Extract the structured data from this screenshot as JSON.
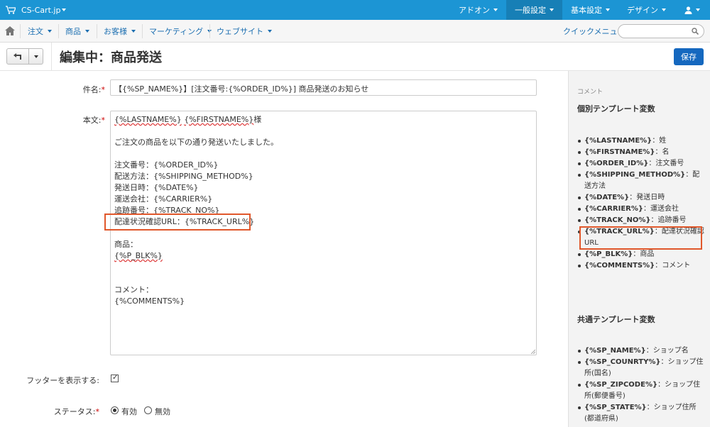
{
  "topbar": {
    "brand": "CS-Cart.jp",
    "menus": [
      {
        "label": "アドオン"
      },
      {
        "label": "一般設定"
      },
      {
        "label": "基本設定"
      },
      {
        "label": "デザイン"
      }
    ]
  },
  "subnav": {
    "items": [
      {
        "label": "注文"
      },
      {
        "label": "商品"
      },
      {
        "label": "お客様"
      },
      {
        "label": "マーケティング"
      },
      {
        "label": "ウェブサイト"
      }
    ],
    "quick_menu": "クイックメニュー",
    "search_placeholder": ""
  },
  "page": {
    "title": "編集中：商品発送",
    "save_label": "保存"
  },
  "form": {
    "subject_label": "件名:",
    "subject_value": "【{%SP_NAME%}】[注文番号:{%ORDER_ID%}] 商品発送のお知らせ",
    "body_label": "本文:",
    "body": {
      "name_a": "{%LASTNAME%}",
      "name_b": "{%FIRSTNAME%}",
      "name_suffix": "様",
      "intro": "ご注文の商品を以下の通り発送いたしました。",
      "order_id": "注文番号：{%ORDER_ID%}",
      "shipping_method": "配送方法：{%SHIPPING_METHOD%}",
      "date": "発送日時：{%DATE%}",
      "carrier": "運送会社：{%CARRIER%}",
      "track_no": "追跡番号：{%TRACK_NO%}",
      "track_url": "配達状況確認URL：{%TRACK_URL%}",
      "products_label": "商品：",
      "p_blk": "{%P_BLK%}",
      "comment_label": "コメント：",
      "comments": "{%COMMENTS%}"
    },
    "footer_label": "フッターを表示する:",
    "status_label": "ステータス:",
    "status_options": [
      {
        "label": "有効",
        "selected": true
      },
      {
        "label": "無効",
        "selected": false
      }
    ]
  },
  "sidebar": {
    "small_label": "コメント",
    "individual_title": "個別テンプレート変数",
    "individual_vars": [
      {
        "var": "{%LASTNAME%}",
        "desc": "：姓"
      },
      {
        "var": "{%FIRSTNAME%}",
        "desc": "：名"
      },
      {
        "var": "{%ORDER_ID%}",
        "desc": "：注文番号"
      },
      {
        "var": "{%SHIPPING_METHOD%}",
        "desc": "：配送方法"
      },
      {
        "var": "{%DATE%}",
        "desc": "：発送日時"
      },
      {
        "var": "{%CARRIER%}",
        "desc": "：運送会社"
      },
      {
        "var": "{%TRACK_NO%}",
        "desc": "：追跡番号"
      },
      {
        "var": "{%TRACK_URL%}",
        "desc": "：配達状況確認URL"
      },
      {
        "var": "{%P_BLK%}",
        "desc": "：商品"
      },
      {
        "var": "{%COMMENTS%}",
        "desc": "：コメント"
      }
    ],
    "common_title": "共通テンプレート変数",
    "common_vars": [
      {
        "var": "{%SP_NAME%}",
        "desc": "：ショップ名"
      },
      {
        "var": "{%SP_COUNRTY%}",
        "desc": "：ショップ住所(国名)"
      },
      {
        "var": "{%SP_ZIPCODE%}",
        "desc": "：ショップ住所(郵便番号)"
      },
      {
        "var": "{%SP_STATE%}",
        "desc": "：ショップ住所(都道府県)"
      }
    ]
  },
  "colors": {
    "topbar": "#1c95d4",
    "primary_button": "#1568bf",
    "highlight": "#e0572b",
    "link": "#1c6fb1"
  }
}
